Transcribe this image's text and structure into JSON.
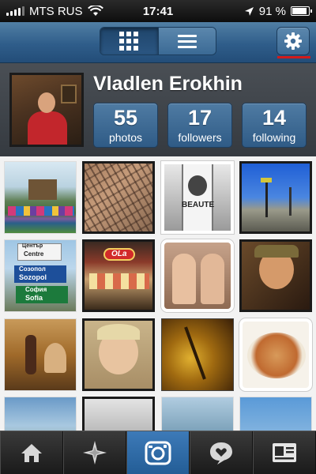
{
  "status_bar": {
    "carrier": "MTS RUS",
    "time": "17:41",
    "battery": "91 %",
    "battery_level": 0.91
  },
  "navbar": {
    "view_toggle": {
      "selected": "grid"
    },
    "icons": [
      "grid-icon",
      "list-icon",
      "gear-icon"
    ]
  },
  "profile": {
    "username": "Vladlen Erokhin",
    "stats": [
      {
        "value": "55",
        "label": "photos"
      },
      {
        "value": "17",
        "label": "followers"
      },
      {
        "value": "14",
        "label": "following"
      }
    ]
  },
  "photos": [
    {
      "sign_lines": []
    },
    {
      "sign_lines": []
    },
    {
      "sign_lines": [
        "BEAUTE"
      ]
    },
    {
      "sign_lines": []
    },
    {
      "sign_lines": [
        "Център",
        "Centre",
        "Созопол",
        "Sozopol",
        "София",
        "Sofia"
      ]
    },
    {
      "sign_lines": [
        "OLa"
      ]
    },
    {
      "sign_lines": []
    },
    {
      "sign_lines": []
    },
    {
      "sign_lines": []
    },
    {
      "sign_lines": []
    },
    {
      "sign_lines": []
    },
    {
      "sign_lines": []
    },
    {
      "sign_lines": []
    },
    {
      "sign_lines": []
    },
    {
      "sign_lines": []
    },
    {
      "sign_lines": []
    }
  ],
  "tabbar": {
    "selected": "profile",
    "tabs": [
      {
        "name": "home",
        "icon": "home-icon"
      },
      {
        "name": "explore",
        "icon": "compass-star-icon"
      },
      {
        "name": "camera",
        "icon": "camera-icon"
      },
      {
        "name": "news",
        "icon": "speech-heart-icon"
      },
      {
        "name": "profile",
        "icon": "profile-card-icon"
      }
    ]
  },
  "colors": {
    "nav_blue": "#2f5d8a",
    "stat_blue": "#3f6b96",
    "settings_underline": "#d11b1b",
    "tab_active": "#2f6aa6"
  }
}
